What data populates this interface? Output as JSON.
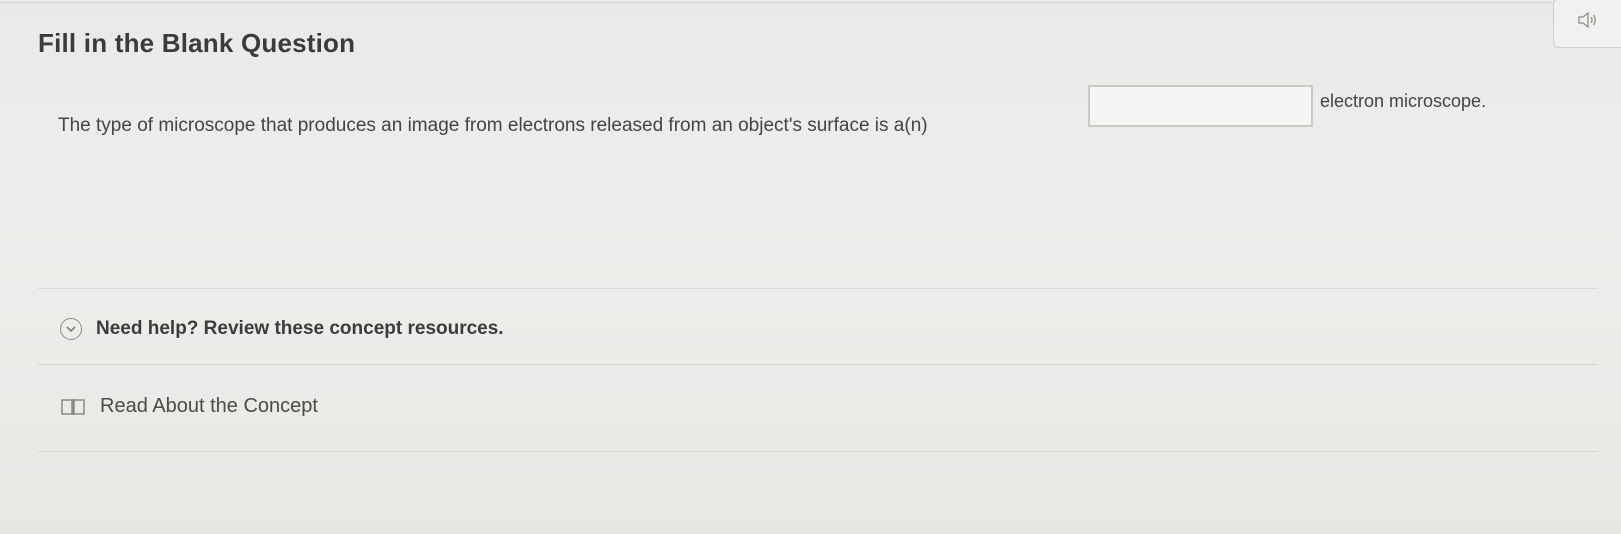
{
  "question": {
    "title": "Fill in the Blank Question",
    "text_before": "The type of microscope that produces an image from electrons released from an object's surface is a(n)",
    "blank_value": "",
    "text_after": "electron microscope."
  },
  "help": {
    "label": "Need help? Review these concept resources.",
    "resource_label": "Read About the Concept"
  },
  "icons": {
    "audio": "speaker-icon",
    "expand": "chevron-down-icon",
    "resource": "book-icon"
  }
}
